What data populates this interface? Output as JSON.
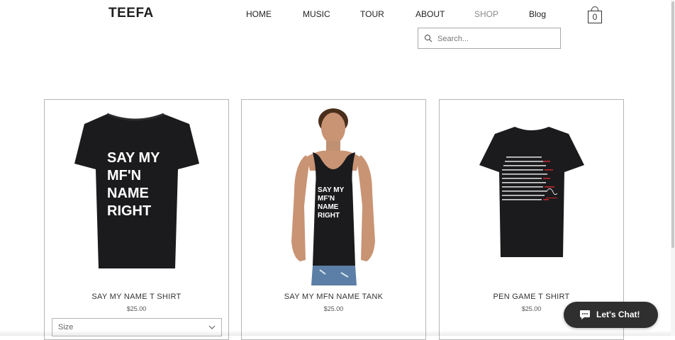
{
  "site": {
    "logo": "TEEFA"
  },
  "nav": {
    "items": [
      {
        "label": "HOME",
        "active": false
      },
      {
        "label": "MUSIC",
        "active": false
      },
      {
        "label": "TOUR",
        "active": false
      },
      {
        "label": "ABOUT",
        "active": false
      },
      {
        "label": "SHOP",
        "active": true
      },
      {
        "label": "Blog",
        "active": false
      }
    ]
  },
  "cart": {
    "count": "0",
    "icon": "shopping-bag-icon"
  },
  "search": {
    "placeholder": "Search...",
    "value": "",
    "icon": "search-icon"
  },
  "products": [
    {
      "name": "SAY MY NAME T SHIRT",
      "price": "$25.00",
      "print": [
        "SAY MY",
        "MF'N",
        "NAME",
        "RIGHT"
      ],
      "size_label": "Size"
    },
    {
      "name": "SAY MY MFN NAME TANK",
      "price": "$25.00",
      "print": [
        "SAY MY",
        "MF'N",
        "NAME",
        "RIGHT"
      ]
    },
    {
      "name": "PEN GAME T SHIRT",
      "price": "$25.00"
    }
  ],
  "chat": {
    "label": "Let's Chat!",
    "icon": "chat-bubble-icon"
  },
  "colors": {
    "text": "#222222",
    "active_nav": "#8a8a8a",
    "border": "#b5b5b5",
    "chat_bg": "#2f2f2f",
    "shirt": "#1b1b1d",
    "accent_red": "#c0282d"
  }
}
